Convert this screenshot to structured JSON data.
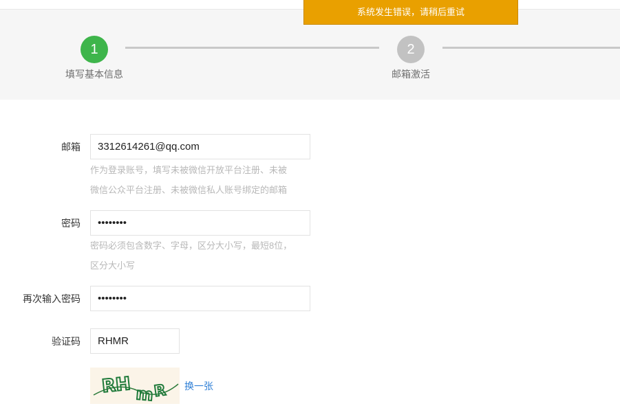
{
  "toast": {
    "message": "系统发生错误，请稍后重试"
  },
  "steps": [
    {
      "number": "1",
      "label": "填写基本信息",
      "state": "active"
    },
    {
      "number": "2",
      "label": "邮箱激活",
      "state": "pending"
    }
  ],
  "form": {
    "email": {
      "label": "邮箱",
      "value": "3312614261@qq.com",
      "hint_line1": "作为登录账号，填写未被微信开放平台注册、未被",
      "hint_line2": "微信公众平台注册、未被微信私人账号绑定的邮箱"
    },
    "password": {
      "label": "密码",
      "value": "••••••••",
      "hint_line1": "密码必须包含数字、字母，区分大小写，最短8位，",
      "hint_line2": "区分大小写"
    },
    "confirm_password": {
      "label": "再次输入密码",
      "value": "••••••••"
    },
    "captcha": {
      "label": "验证码",
      "value": "RHMR",
      "image_text": "RHmR",
      "change_label": "换一张"
    }
  },
  "colors": {
    "step_active": "#3eb54b",
    "step_pending": "#c2c2c2",
    "toast_bg": "#e9a000",
    "link": "#2f7fd6"
  }
}
